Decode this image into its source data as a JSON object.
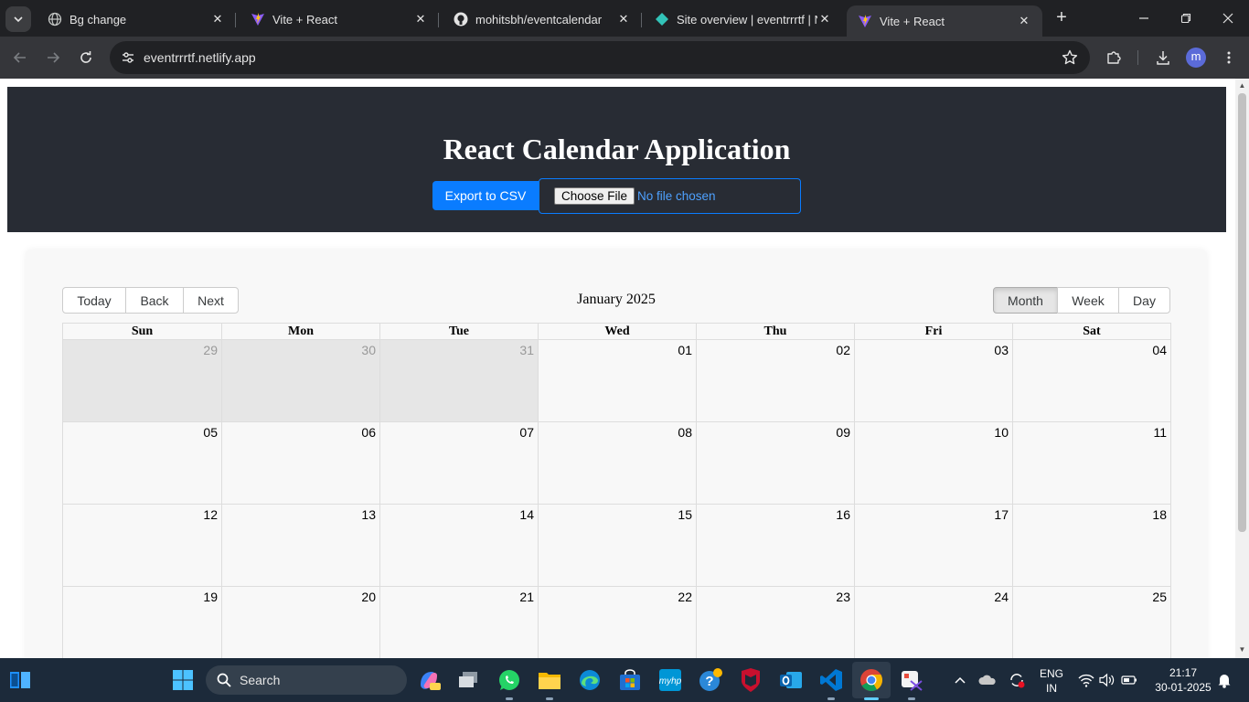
{
  "browser": {
    "tabs": [
      {
        "title": "Bg change",
        "icon": "globe-icon",
        "active": false
      },
      {
        "title": "Vite + React",
        "icon": "vite-icon",
        "active": false
      },
      {
        "title": "mohitsbh/eventcalendar",
        "icon": "github-icon",
        "active": false
      },
      {
        "title": "Site overview | eventrrrtf | Ne",
        "icon": "netlify-icon",
        "active": false
      },
      {
        "title": "Vite + React",
        "icon": "vite-icon",
        "active": true
      }
    ],
    "url": "eventrrrtf.netlify.app",
    "profile_initial": "m"
  },
  "app": {
    "title": "React Calendar Application",
    "export_label": "Export to CSV",
    "file_button_label": "Choose File",
    "file_status": "No file chosen"
  },
  "calendar": {
    "nav_buttons": [
      "Today",
      "Back",
      "Next"
    ],
    "label": "January 2025",
    "view_buttons": [
      "Month",
      "Week",
      "Day"
    ],
    "active_view": "Month",
    "weekdays": [
      "Sun",
      "Mon",
      "Tue",
      "Wed",
      "Thu",
      "Fri",
      "Sat"
    ],
    "weeks": [
      [
        {
          "d": "29",
          "off": true
        },
        {
          "d": "30",
          "off": true
        },
        {
          "d": "31",
          "off": true
        },
        {
          "d": "01"
        },
        {
          "d": "02"
        },
        {
          "d": "03"
        },
        {
          "d": "04"
        }
      ],
      [
        {
          "d": "05"
        },
        {
          "d": "06"
        },
        {
          "d": "07"
        },
        {
          "d": "08"
        },
        {
          "d": "09"
        },
        {
          "d": "10"
        },
        {
          "d": "11"
        }
      ],
      [
        {
          "d": "12"
        },
        {
          "d": "13"
        },
        {
          "d": "14"
        },
        {
          "d": "15"
        },
        {
          "d": "16"
        },
        {
          "d": "17"
        },
        {
          "d": "18"
        }
      ],
      [
        {
          "d": "19"
        },
        {
          "d": "20"
        },
        {
          "d": "21"
        },
        {
          "d": "22"
        },
        {
          "d": "23"
        },
        {
          "d": "24"
        },
        {
          "d": "25"
        }
      ]
    ]
  },
  "taskbar": {
    "search_label": "Search",
    "lang_top": "ENG",
    "lang_bottom": "IN",
    "time": "21:17",
    "date": "30-01-2025"
  },
  "colors": {
    "header_bg": "#282c34",
    "accent": "#0a7cff",
    "off_day": "#e6e6e6"
  }
}
